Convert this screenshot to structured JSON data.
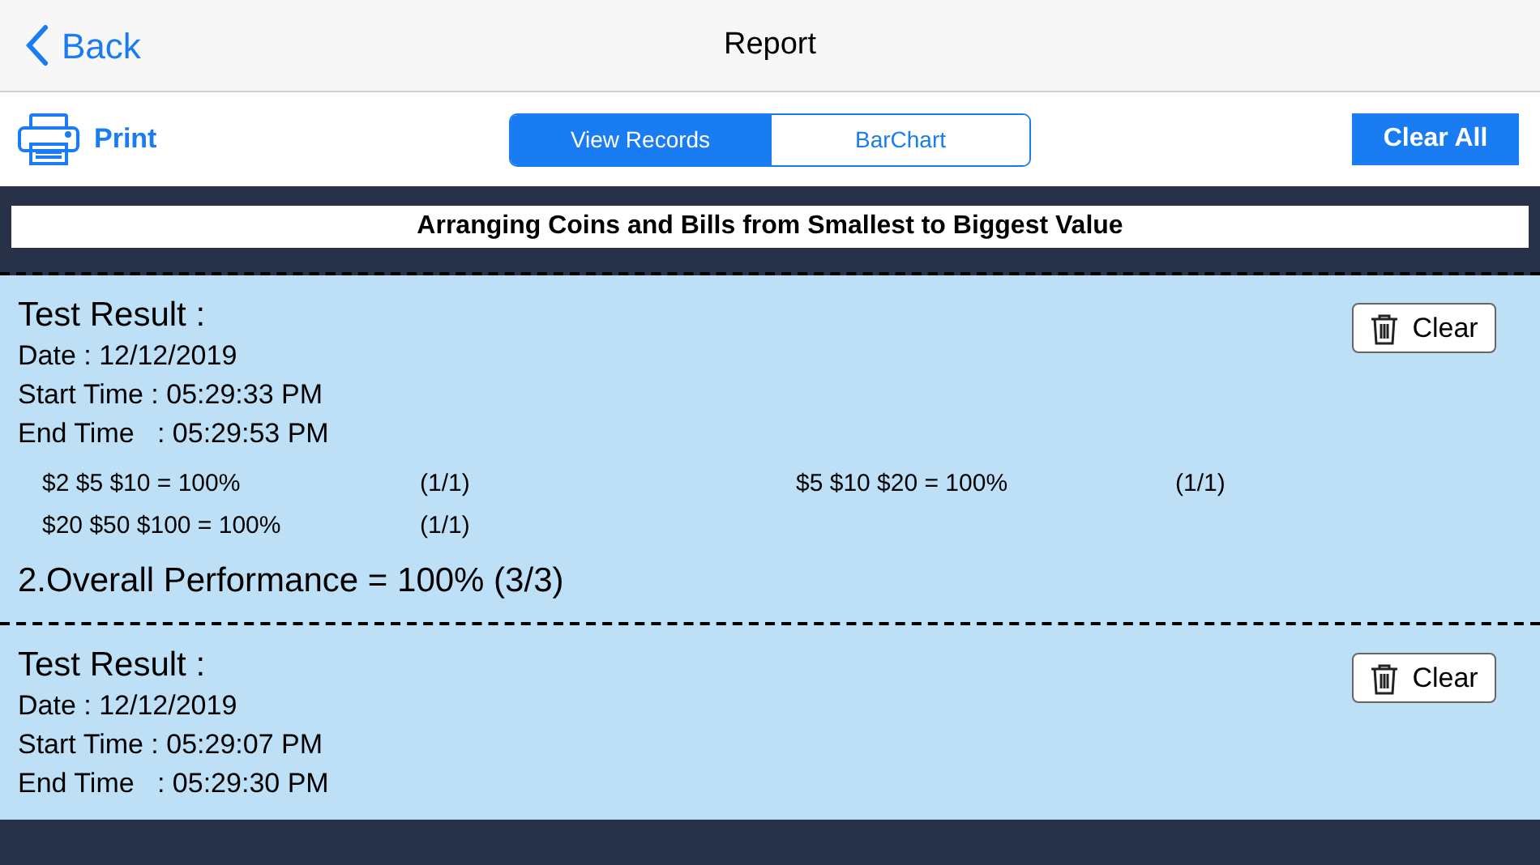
{
  "nav": {
    "back": "Back",
    "title": "Report"
  },
  "toolbar": {
    "print": "Print",
    "tabs": [
      {
        "label": "View Records",
        "selected": true
      },
      {
        "label": "BarChart",
        "selected": false
      }
    ],
    "clear_all": "Clear All"
  },
  "heading": "Arranging Coins and Bills from Smallest to Biggest Value",
  "records": [
    {
      "title": "Test Result :",
      "date": "Date : 12/12/2019",
      "start": "Start Time : 05:29:33 PM",
      "end": "End Time   : 05:29:53 PM",
      "clear": "Clear",
      "items": [
        {
          "label": "$2 $5 $10 = 100%",
          "score": "(1/1)"
        },
        {
          "label": "$5 $10 $20 = 100%",
          "score": "(1/1)"
        },
        {
          "label": "$20 $50 $100 = 100%",
          "score": "(1/1)"
        }
      ],
      "overall": "2.Overall Performance = 100% (3/3)"
    },
    {
      "title": "Test Result :",
      "date": "Date : 12/12/2019",
      "start": "Start Time : 05:29:07 PM",
      "end": "End Time   : 05:29:30 PM",
      "clear": "Clear"
    }
  ]
}
